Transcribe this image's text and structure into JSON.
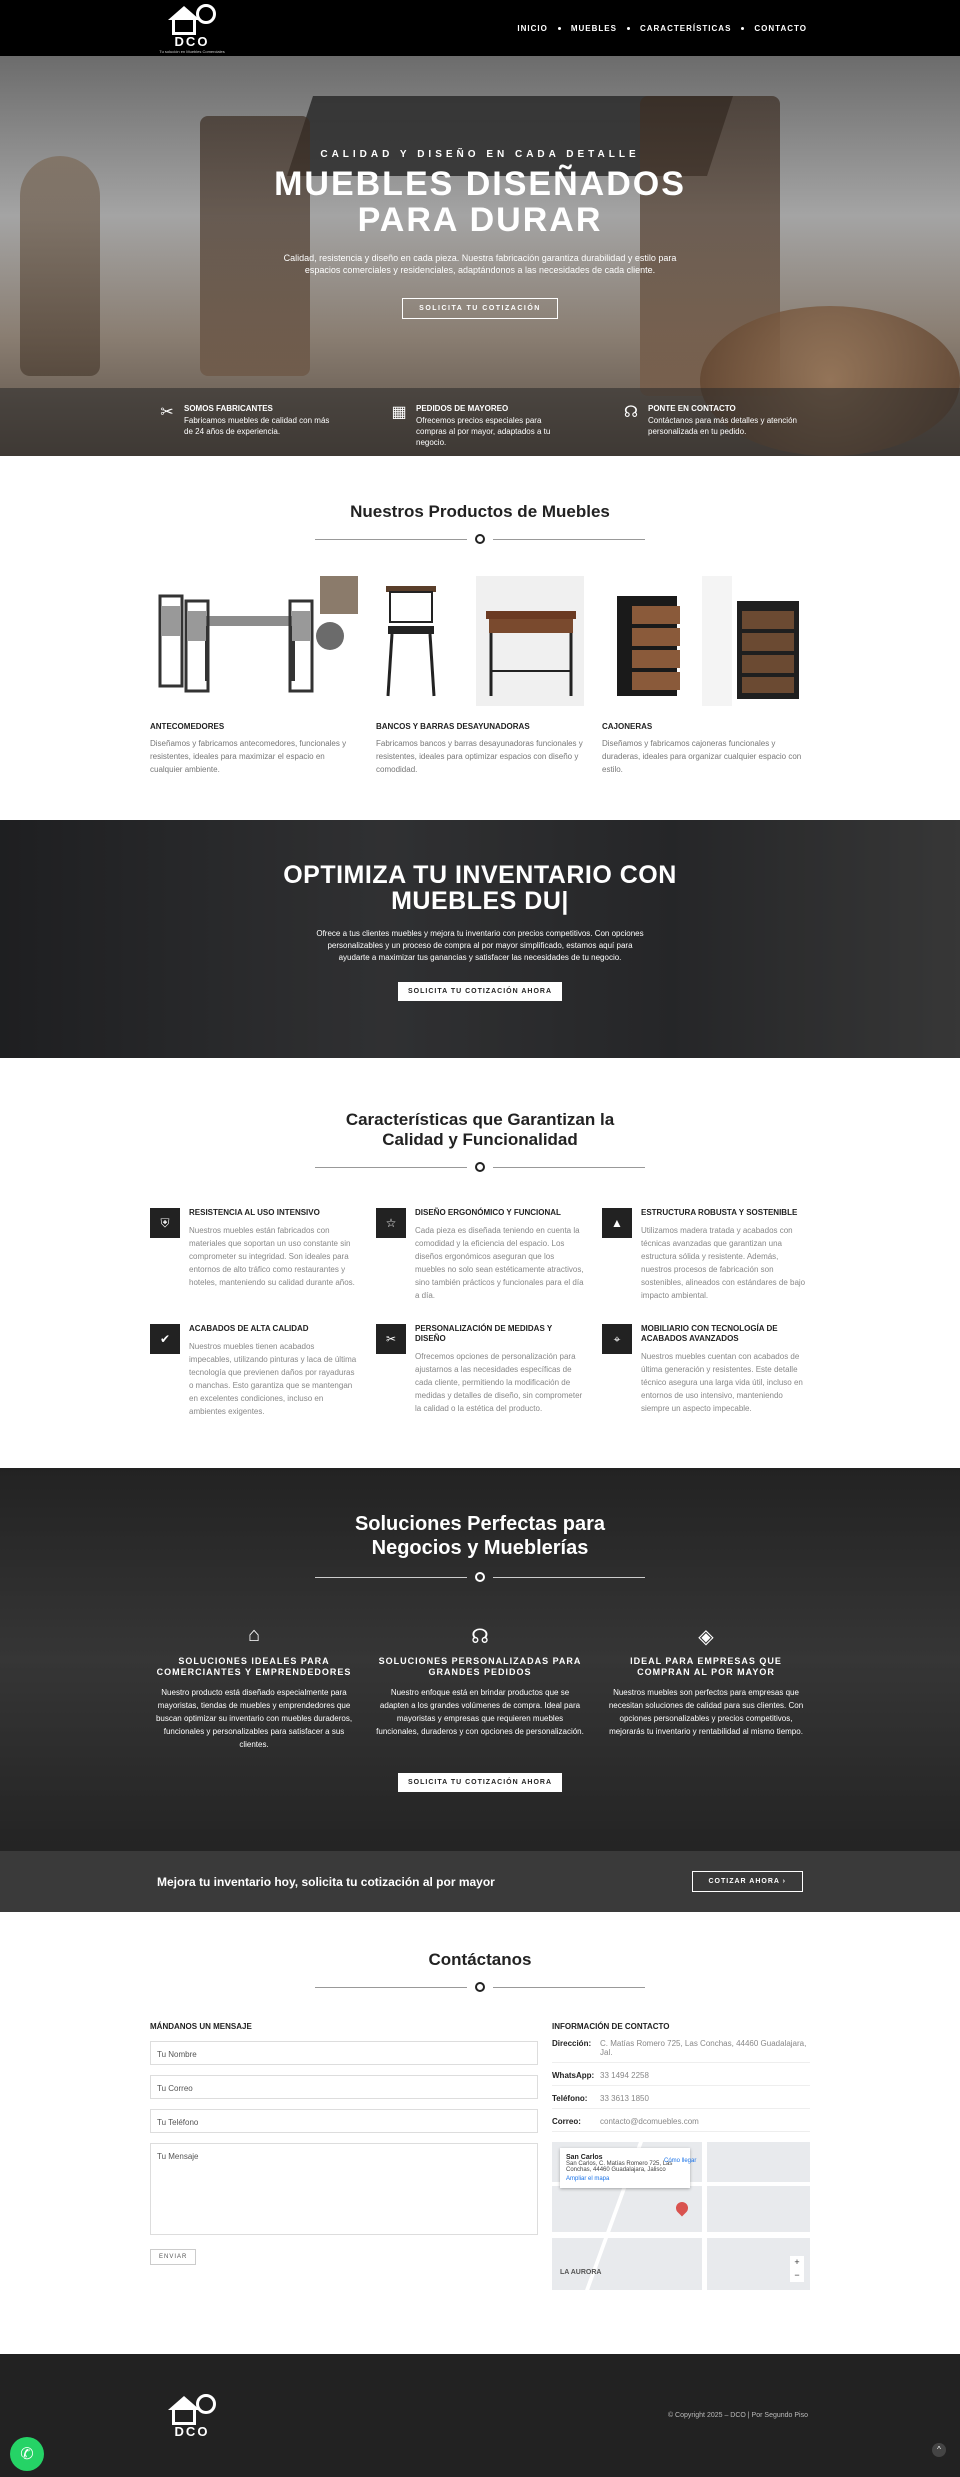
{
  "header": {
    "logo_text": "DCO",
    "logo_sub": "Tu solución en Muebles Comerciales",
    "nav": [
      "INICIO",
      "MUEBLES",
      "CARACTERÍSTICAS",
      "CONTACTO"
    ]
  },
  "hero": {
    "eyebrow": "CALIDAD Y DISEÑO EN CADA DETALLE",
    "title": "MUEBLES DISEÑADOS PARA DURAR",
    "description": "Calidad, resistencia y diseño en cada pieza. Nuestra fabricación garantiza durabilidad y estilo para espacios comerciales y residenciales, adaptándonos a las necesidades de cada cliente.",
    "cta": "SOLICITA TU COTIZACIÓN",
    "features": [
      {
        "icon": "tools-icon",
        "title": "SOMOS FABRICANTES",
        "text": "Fabricamos muebles de calidad con más de 24 años de experiencia."
      },
      {
        "icon": "boxes-icon",
        "title": "PEDIDOS DE MAYOREO",
        "text": "Ofrecemos precios especiales para compras al por mayor, adaptados a tu negocio."
      },
      {
        "icon": "headset-icon",
        "title": "PONTE EN CONTACTO",
        "text": "Contáctanos para más detalles y atención personalizada en tu pedido."
      }
    ]
  },
  "products": {
    "title": "Nuestros Productos de Muebles",
    "items": [
      {
        "name": "ANTECOMEDORES",
        "desc": "Diseñamos y fabricamos antecomedores, funcionales y resistentes, ideales para maximizar el espacio en cualquier ambiente."
      },
      {
        "name": "BANCOS Y BARRAS DESAYUNADORAS",
        "desc": "Fabricamos bancos y barras desayunadoras funcionales y resistentes, ideales para optimizar espacios con diseño y comodidad."
      },
      {
        "name": "CAJONERAS",
        "desc": "Diseñamos y fabricamos cajoneras funcionales y duraderas, ideales para organizar cualquier espacio con estilo."
      }
    ]
  },
  "band": {
    "title": "OPTIMIZA TU INVENTARIO CON MUEBLES DU|",
    "description": "Ofrece a tus clientes muebles y mejora tu inventario con precios competitivos. Con opciones personalizables y un proceso de compra al por mayor simplificado, estamos aquí para ayudarte a maximizar tus ganancias y satisfacer las necesidades de tu negocio.",
    "cta": "SOLICITA TU COTIZACIÓN AHORA"
  },
  "features": {
    "title": "Características que Garantizan la Calidad y Funcionalidad",
    "items": [
      {
        "icon": "shield-icon",
        "title": "RESISTENCIA AL USO INTENSIVO",
        "text": "Nuestros muebles están fabricados con materiales que soportan un uso constante sin comprometer su integridad. Son ideales para entornos de alto tráfico como restaurantes y hoteles, manteniendo su calidad durante años."
      },
      {
        "icon": "star-icon",
        "title": "DISEÑO ERGONÓMICO Y FUNCIONAL",
        "text": "Cada pieza es diseñada teniendo en cuenta la comodidad y la eficiencia del espacio. Los diseños ergonómicos aseguran que los muebles no solo sean estéticamente atractivos, sino también prácticos y funcionales para el día a día."
      },
      {
        "icon": "building-icon",
        "title": "ESTRUCTURA ROBUSTA Y SOSTENIBLE",
        "text": "Utilizamos madera tratada y acabados con técnicas avanzadas que garantizan una estructura sólida y resistente. Además, nuestros procesos de fabricación son sostenibles, alineados con estándares de bajo impacto ambiental."
      },
      {
        "icon": "check-circle-icon",
        "title": "ACABADOS DE ALTA CALIDAD",
        "text": "Nuestros muebles tienen acabados impecables, utilizando pinturas y laca de última tecnología que previenen daños por rayaduras o manchas. Esto garantiza que se mantengan en excelentes condiciones, incluso en ambientes exigentes."
      },
      {
        "icon": "tools-icon",
        "title": "PERSONALIZACIÓN DE MEDIDAS Y DISEÑO",
        "text": "Ofrecemos opciones de personalización para ajustarnos a las necesidades específicas de cada cliente, permitiendo la modificación de medidas y detalles de diseño, sin comprometer la calidad o la estética del producto."
      },
      {
        "icon": "compass-icon",
        "title": "MOBILIARIO CON TECNOLOGÍA DE ACABADOS AVANZADOS",
        "text": "Nuestros muebles cuentan con acabados de última generación y resistentes. Este detalle técnico asegura una larga vida útil, incluso en entornos de uso intensivo, manteniendo siempre un aspecto impecable."
      }
    ]
  },
  "solutions": {
    "title": "Soluciones Perfectas para Negocios y Mueblerías",
    "items": [
      {
        "icon": "store-icon",
        "title": "SOLUCIONES IDEALES PARA COMERCIANTES Y EMPRENDEDORES",
        "text": "Nuestro producto está diseñado especialmente para mayoristas, tiendas de muebles y emprendedores que buscan optimizar su inventario con muebles duraderos, funcionales y personalizables para satisfacer a sus clientes."
      },
      {
        "icon": "headset-icon",
        "title": "SOLUCIONES PERSONALIZADAS PARA GRANDES PEDIDOS",
        "text": "Nuestro enfoque está en brindar productos que se adapten a los grandes volúmenes de compra. Ideal para mayoristas y empresas que requieren muebles funcionales, duraderos y con opciones de personalización."
      },
      {
        "icon": "tags-icon",
        "title": "IDEAL PARA EMPRESAS QUE COMPRAN AL POR MAYOR",
        "text": "Nuestros muebles son perfectos para empresas que necesitan soluciones de calidad para sus clientes. Con opciones personalizables y precios competitivos, mejorarás tu inventario y rentabilidad al mismo tiempo."
      }
    ],
    "cta": "SOLICITA TU COTIZACIÓN AHORA"
  },
  "cta_bar": {
    "text": "Mejora tu inventario hoy, solicita tu cotización al por mayor",
    "button": "COTIZAR AHORA"
  },
  "contact": {
    "title": "Contáctanos",
    "form_title": "MÁNDANOS UN MENSAJE",
    "fields": {
      "name": "Tu Nombre",
      "email": "Tu Correo",
      "phone": "Tu Teléfono",
      "message": "Tu Mensaje"
    },
    "submit": "ENVIAR",
    "info_title": "INFORMACIÓN DE CONTACTO",
    "info": [
      {
        "label": "Dirección:",
        "value": "C. Matías Romero 725, Las Conchas, 44460 Guadalajara, Jal."
      },
      {
        "label": "WhatsApp:",
        "value": "33 1494 2258"
      },
      {
        "label": "Teléfono:",
        "value": "33 3613 1850"
      },
      {
        "label": "Correo:",
        "value": "contacto@dcomuebles.com"
      }
    ],
    "map": {
      "place": "San Carlos",
      "address": "San Carlos, C. Matías Romero 725, Las Conchas, 44460 Guadalajara, Jalisco",
      "link": "Ampliar el mapa",
      "directions": "Cómo llegar",
      "area": "LA AURORA"
    }
  },
  "footer": {
    "copyright": "© Copyright 2025 – DCO | Por Segundo Piso"
  }
}
